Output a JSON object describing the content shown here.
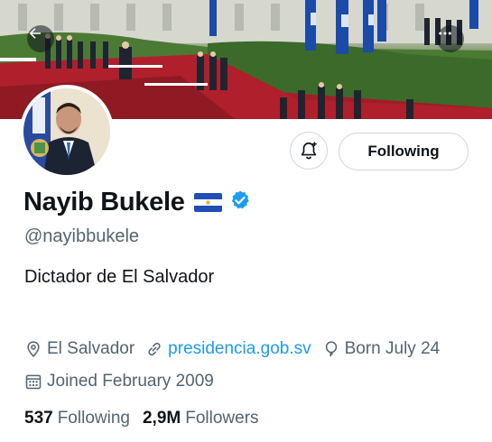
{
  "profile": {
    "name": "Nayib Bukele",
    "handle": "@nayibbukele",
    "bio": "Dictador de El Salvador",
    "location": "El Salvador",
    "website": "presidencia.gob.sv",
    "birthday": "Born July 24",
    "joined": "Joined February 2009"
  },
  "actions": {
    "follow_label": "Following"
  },
  "stats": {
    "following_count": "537",
    "following_label": "Following",
    "followers_count": "2,9M",
    "followers_label": "Followers"
  },
  "icons": {
    "back": "arrow-left-icon",
    "more": "more-horizontal-icon",
    "notify": "bell-plus-icon",
    "verified": "verified-badge-icon",
    "flag": "el-salvador-flag",
    "location": "map-pin-icon",
    "link": "link-icon",
    "birthday": "balloon-icon",
    "joined": "calendar-icon"
  },
  "colors": {
    "accent": "#1d9bf0",
    "text": "#0f1419",
    "secondary": "#536471",
    "border": "#cfd9de"
  }
}
